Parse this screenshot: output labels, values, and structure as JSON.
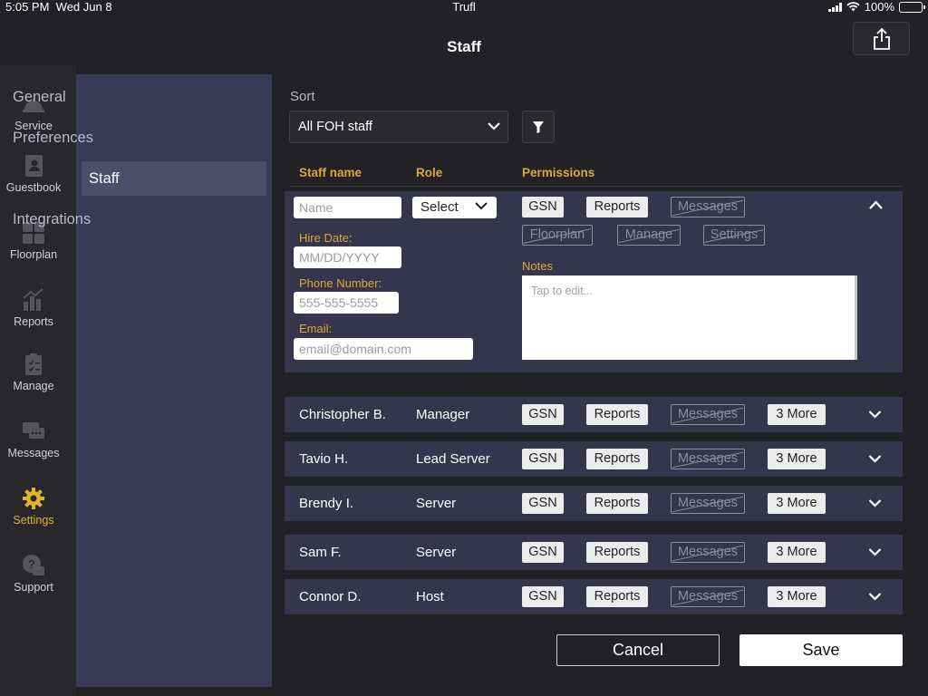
{
  "status_bar": {
    "time": "5:05 PM",
    "date": "Wed Jun 8",
    "carrier": "Trufl",
    "battery": "100%"
  },
  "header": {
    "title": "Staff",
    "share_icon": "share-icon"
  },
  "rail": {
    "active_color": "#e0b42c",
    "items": [
      {
        "label": "Service",
        "icon": "service-bell-icon"
      },
      {
        "label": "Guestbook",
        "icon": "guestbook-icon"
      },
      {
        "label": "Floorplan",
        "icon": "floorplan-icon"
      },
      {
        "label": "Reports",
        "icon": "reports-icon"
      },
      {
        "label": "Manage",
        "icon": "clipboard-icon"
      },
      {
        "label": "Messages",
        "icon": "chat-icon"
      },
      {
        "label": "Settings",
        "icon": "gear-icon",
        "active": true
      },
      {
        "label": "Support",
        "icon": "support-icon"
      }
    ]
  },
  "settings_menu": {
    "items": [
      {
        "label": "General"
      },
      {
        "label": "Preferences"
      },
      {
        "label": "Staff",
        "active": true
      },
      {
        "label": "Integrations"
      }
    ]
  },
  "sort": {
    "label": "Sort",
    "value": "All FOH staff"
  },
  "columns": {
    "name": "Staff name",
    "role": "Role",
    "permissions": "Permissions"
  },
  "new_staff": {
    "name_placeholder": "Name",
    "role_value": "Select",
    "hire_date_label": "Hire Date:",
    "hire_date_placeholder": "MM/DD/YYYY",
    "phone_label": "Phone Number:",
    "phone_placeholder": "555-555-5555",
    "email_label": "Email:",
    "email_placeholder": "email@domain.com",
    "notes_label": "Notes",
    "notes_placeholder": "Tap to edit...",
    "permissions": [
      {
        "label": "GSN",
        "enabled": true
      },
      {
        "label": "Reports",
        "enabled": true
      },
      {
        "label": "Messages",
        "enabled": false
      },
      {
        "label": "Floorplan",
        "enabled": false
      },
      {
        "label": "Manage",
        "enabled": false
      },
      {
        "label": "Settings",
        "enabled": false
      }
    ]
  },
  "staff": [
    {
      "name": "Christopher B.",
      "role": "Manager",
      "p1": "GSN",
      "p2": "Reports",
      "p3": "Messages",
      "more": "3 More"
    },
    {
      "name": "Tavio H.",
      "role": "Lead Server",
      "p1": "GSN",
      "p2": "Reports",
      "p3": "Messages",
      "more": "3 More"
    },
    {
      "name": "Brendy I.",
      "role": "Server",
      "p1": "GSN",
      "p2": "Reports",
      "p3": "Messages",
      "more": "3 More"
    },
    {
      "name": "Sam F.",
      "role": "Server",
      "p1": "GSN",
      "p2": "Reports",
      "p3": "Messages",
      "more": "3 More"
    },
    {
      "name": "Connor D.",
      "role": "Host",
      "p1": "GSN",
      "p2": "Reports",
      "p3": "Messages",
      "more": "3 More"
    }
  ],
  "actions": {
    "cancel": "Cancel",
    "save": "Save"
  }
}
